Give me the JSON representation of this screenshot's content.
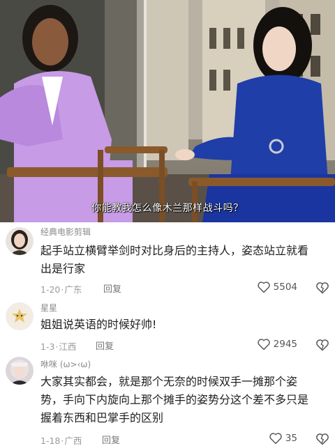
{
  "video": {
    "subtitle": "你能教我怎么像木兰那样战斗吗？"
  },
  "comments": [
    {
      "username": "经典电影剪辑",
      "text_lines": [
        "起手站立横臂举剑时对比身后的主持人，姿态站立就看",
        "出是行家"
      ],
      "date": "1-20",
      "separator": "·",
      "location": "广东",
      "reply_label": "回复",
      "likes": "5504"
    },
    {
      "username": "星星",
      "text_lines": [
        "姐姐说英语的时候好帅!"
      ],
      "date": "1-3",
      "separator": "·",
      "location": "江西",
      "reply_label": "回复",
      "likes": "2945"
    },
    {
      "username": "咻咪 (ω>‹ω)",
      "text_lines": [
        "大家其实都会，就是那个无奈的时候双手一摊那个姿",
        "势，手向下内旋向上那个摊手的姿势分这个差不多只是",
        "握着东西和巴掌手的区别"
      ],
      "date": "1-18",
      "separator": "·",
      "location": "广西",
      "reply_label": "回复",
      "likes": "35"
    }
  ],
  "icons": {
    "like": "heart-outline-icon",
    "dislike": "broken-heart-icon"
  },
  "colors": {
    "left_suit": "#c79be6",
    "right_suit": "#1f3ea8",
    "meta_text": "#9a9a9a"
  }
}
